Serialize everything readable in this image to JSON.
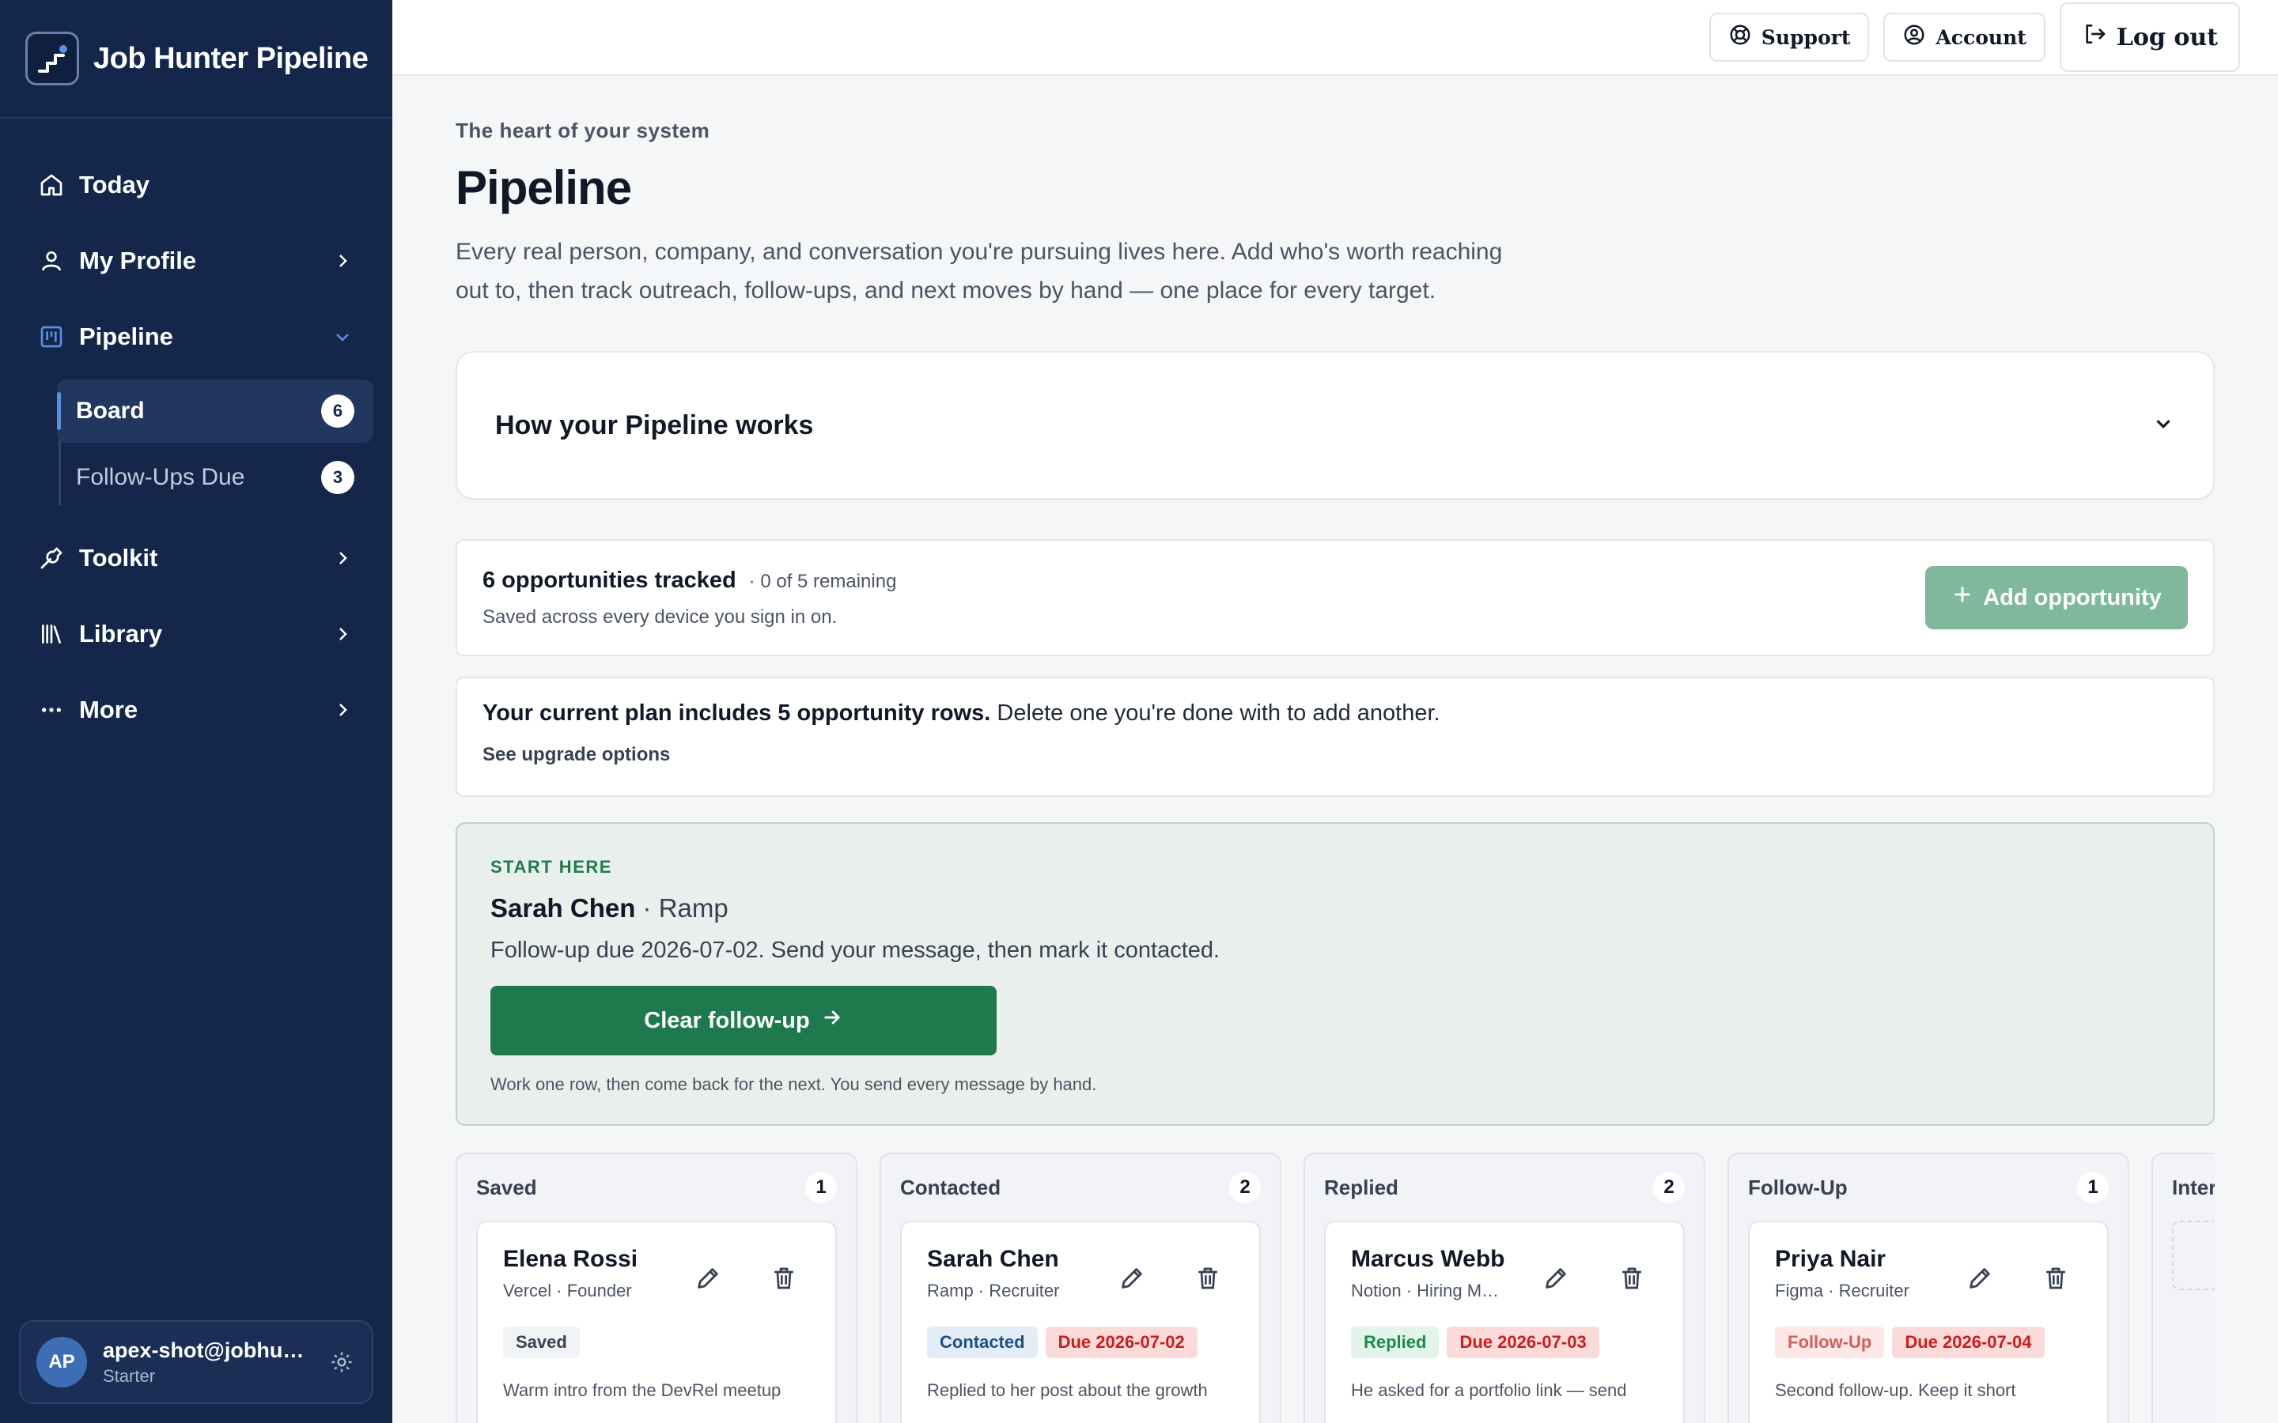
{
  "app": {
    "title": "Job Hunter Pipeline"
  },
  "sidebar": {
    "nav": [
      {
        "label": "Today",
        "icon": "home-icon"
      },
      {
        "label": "My Profile",
        "icon": "user-icon"
      },
      {
        "label": "Pipeline",
        "icon": "board-icon",
        "expanded": true
      },
      {
        "label": "Toolkit",
        "icon": "wrench-icon"
      },
      {
        "label": "Library",
        "icon": "books-icon"
      },
      {
        "label": "More",
        "icon": "dots-icon"
      }
    ],
    "pipeline_sub": [
      {
        "label": "Board",
        "count": "6",
        "active": true
      },
      {
        "label": "Follow-Ups Due",
        "count": "3",
        "active": false
      }
    ],
    "user": {
      "initials": "AP",
      "email": "apex-shot@jobhunterpipeline.com",
      "plan": "Starter"
    }
  },
  "topbar": {
    "support": "Support",
    "account": "Account",
    "logout": "Log out"
  },
  "page": {
    "eyebrow": "The heart of your system",
    "title": "Pipeline",
    "description": "Every real person, company, and conversation you're pursuing lives here. Add who's worth reaching out to, then track outreach, follow-ups, and next moves by hand — one place for every target."
  },
  "how": {
    "title": "How your Pipeline works"
  },
  "stats": {
    "tracked": "6 opportunities tracked",
    "remaining": "· 0 of 5 remaining",
    "sub": "Saved across every device you sign in on.",
    "add_label": "Add opportunity"
  },
  "plan": {
    "bold": "Your current plan includes 5 opportunity rows.",
    "rest": " Delete one you're done with to add another.",
    "link": "See upgrade options"
  },
  "start": {
    "eyebrow": "START HERE",
    "name": "Sarah Chen",
    "company": " · Ramp",
    "desc": "Follow-up due 2026-07-02. Send your message, then mark it contacted.",
    "button": "Clear follow-up",
    "foot": "Work one row, then come back for the next. You send every message by hand."
  },
  "board": {
    "columns": [
      {
        "title": "Saved",
        "count": "1",
        "card": {
          "name": "Elena Rossi",
          "meta": "Vercel · Founder",
          "status": "Saved",
          "status_class": "saved",
          "due": "",
          "note": "Warm intro from the DevRel meetup"
        }
      },
      {
        "title": "Contacted",
        "count": "2",
        "card": {
          "name": "Sarah Chen",
          "meta": "Ramp · Recruiter",
          "status": "Contacted",
          "status_class": "contacted",
          "due": "Due 2026-07-02",
          "note": "Replied to her post about the growth"
        }
      },
      {
        "title": "Replied",
        "count": "2",
        "card": {
          "name": "Marcus Webb",
          "meta": "Notion · Hiring Manager",
          "status": "Replied",
          "status_class": "replied",
          "due": "Due 2026-07-03",
          "note": "He asked for a portfolio link — send"
        }
      },
      {
        "title": "Follow-Up",
        "count": "1",
        "card": {
          "name": "Priya Nair",
          "meta": "Figma · Recruiter",
          "status": "Follow-Up",
          "status_class": "followup",
          "due": "Due 2026-07-04",
          "note": "Second follow-up. Keep it short"
        }
      },
      {
        "title": "Inter",
        "count": ""
      }
    ]
  },
  "colors": {
    "sidebar": "#14264a",
    "accent_green": "#1e7a4c",
    "add_button": "#7fb89a",
    "due_red": "#c81e1e"
  }
}
